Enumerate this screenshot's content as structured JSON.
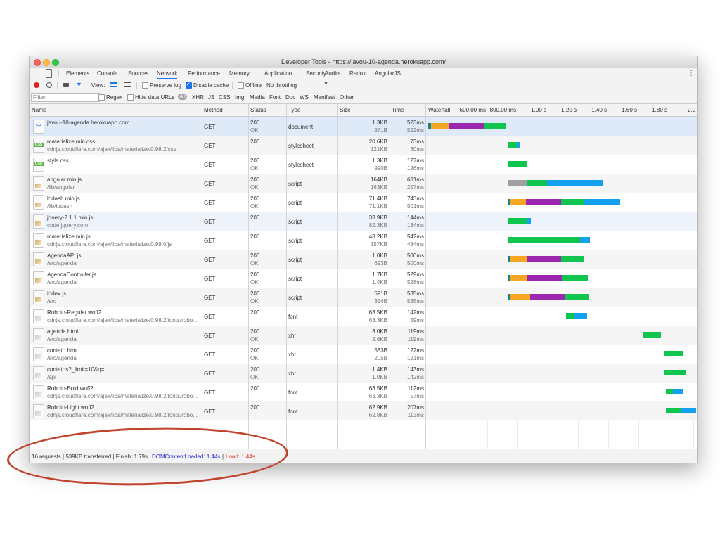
{
  "window": {
    "title": "Developer Tools - https://javou-10-agenda.herokuapp.com/"
  },
  "tabs": [
    "Elements",
    "Console",
    "Sources",
    "Network",
    "Performance",
    "Memory",
    "Application",
    "Security",
    "Audits",
    "Redux",
    "AngularJS"
  ],
  "active_tab": "Network",
  "toolbar": {
    "view_label": "View:",
    "preserve_log": "Preserve log",
    "disable_cache": "Disable cache",
    "offline": "Offline",
    "throttling": "No throttling"
  },
  "filterbar": {
    "filter_placeholder": "Filter",
    "regex": "Regex",
    "hide_data_urls": "Hide data URLs",
    "types": [
      "All",
      "XHR",
      "JS",
      "CSS",
      "Img",
      "Media",
      "Font",
      "Doc",
      "WS",
      "Manifest",
      "Other"
    ]
  },
  "columns": {
    "name": "Name",
    "method": "Method",
    "status": "Status",
    "type": "Type",
    "size": "Size",
    "time": "Time",
    "waterfall": "Waterfall"
  },
  "timeline_ticks": [
    "600.00 ms",
    "800.00 ms",
    "1.00 s",
    "1.20 s",
    "1.40 s",
    "1.60 s",
    "1.80 s",
    "2.0"
  ],
  "requests": [
    {
      "name": "javou-10-agenda.herokuapp.com",
      "path": "",
      "method": "GET",
      "status": "200",
      "status_text": "OK",
      "type": "document",
      "size": "1.3KB",
      "size2": "971B",
      "time": "523ms",
      "time2": "522ms",
      "icon": "html-file-icon"
    },
    {
      "name": "materialize.min.css",
      "path": "cdnjs.cloudflare.com/ajax/libs/materialize/0.98.2/css",
      "method": "GET",
      "status": "200",
      "status_text": "",
      "type": "stylesheet",
      "size": "20.6KB",
      "size2": "121KB",
      "time": "73ms",
      "time2": "60ms",
      "icon": "css-file-icon"
    },
    {
      "name": "style.css",
      "path": "",
      "method": "GET",
      "status": "200",
      "status_text": "OK",
      "type": "stylesheet",
      "size": "1.3KB",
      "size2": "990B",
      "time": "127ms",
      "time2": "126ms",
      "icon": "css-file-icon"
    },
    {
      "name": "angular.min.js",
      "path": "/lib/angular",
      "method": "GET",
      "status": "200",
      "status_text": "OK",
      "type": "script",
      "size": "164KB",
      "size2": "163KB",
      "time": "631ms",
      "time2": "257ms",
      "icon": "js-file-icon"
    },
    {
      "name": "lodash.min.js",
      "path": "/lib/lodash",
      "method": "GET",
      "status": "200",
      "status_text": "OK",
      "type": "script",
      "size": "71.4KB",
      "size2": "71.1KB",
      "time": "743ms",
      "time2": "501ms",
      "icon": "js-file-icon"
    },
    {
      "name": "jquery-2.1.1.min.js",
      "path": "code.jquery.com",
      "method": "GET",
      "status": "200",
      "status_text": "",
      "type": "script",
      "size": "33.9KB",
      "size2": "82.3KB",
      "time": "144ms",
      "time2": "134ms",
      "icon": "js-file-icon"
    },
    {
      "name": "materialize.min.js",
      "path": "cdnjs.cloudflare.com/ajax/libs/materialize/0.99.0/js",
      "method": "GET",
      "status": "200",
      "status_text": "",
      "type": "script",
      "size": "48.2KB",
      "size2": "157KB",
      "time": "542ms",
      "time2": "484ms",
      "icon": "js-file-icon"
    },
    {
      "name": "AgendaAPI.js",
      "path": "/src/agenda",
      "method": "GET",
      "status": "200",
      "status_text": "OK",
      "type": "script",
      "size": "1.0KB",
      "size2": "693B",
      "time": "500ms",
      "time2": "500ms",
      "icon": "js-file-icon"
    },
    {
      "name": "AgendaController.js",
      "path": "/src/agenda",
      "method": "GET",
      "status": "200",
      "status_text": "OK",
      "type": "script",
      "size": "1.7KB",
      "size2": "1.4KB",
      "time": "529ms",
      "time2": "528ms",
      "icon": "js-file-icon"
    },
    {
      "name": "index.js",
      "path": "/src",
      "method": "GET",
      "status": "200",
      "status_text": "OK",
      "type": "script",
      "size": "691B",
      "size2": "314B",
      "time": "535ms",
      "time2": "535ms",
      "icon": "js-file-icon"
    },
    {
      "name": "Roboto-Regular.woff2",
      "path": "cdnjs.cloudflare.com/ajax/libs/materialize/0.98.2/fonts/robo...",
      "method": "GET",
      "status": "200",
      "status_text": "",
      "type": "font",
      "size": "63.5KB",
      "size2": "63.3KB",
      "time": "142ms",
      "time2": "59ms",
      "icon": "font-file-icon"
    },
    {
      "name": "agenda.html",
      "path": "/src/agenda",
      "method": "GET",
      "status": "200",
      "status_text": "OK",
      "type": "xhr",
      "size": "3.0KB",
      "size2": "2.6KB",
      "time": "119ms",
      "time2": "119ms",
      "icon": "font-file-icon"
    },
    {
      "name": "contato.html",
      "path": "/src/agenda",
      "method": "GET",
      "status": "200",
      "status_text": "OK",
      "type": "xhr",
      "size": "583B",
      "size2": "205B",
      "time": "122ms",
      "time2": "121ms",
      "icon": "font-file-icon"
    },
    {
      "name": "contatos?_limit=10&q=",
      "path": "/api",
      "method": "GET",
      "status": "200",
      "status_text": "OK",
      "type": "xhr",
      "size": "1.4KB",
      "size2": "1.0KB",
      "time": "143ms",
      "time2": "142ms",
      "icon": "font-file-icon"
    },
    {
      "name": "Roboto-Bold.woff2",
      "path": "cdnjs.cloudflare.com/ajax/libs/materialize/0.98.2/fonts/robo...",
      "method": "GET",
      "status": "200",
      "status_text": "",
      "type": "font",
      "size": "63.5KB",
      "size2": "63.3KB",
      "time": "112ms",
      "time2": "57ms",
      "icon": "font-file-icon"
    },
    {
      "name": "Roboto-Light.woff2",
      "path": "cdnjs.cloudflare.com/ajax/libs/materialize/0.98.2/fonts/robo...",
      "method": "GET",
      "status": "200",
      "status_text": "",
      "type": "font",
      "size": "62.9KB",
      "size2": "62.8KB",
      "time": "207ms",
      "time2": "113ms",
      "icon": "font-file-icon"
    }
  ],
  "status_bar": {
    "summary": "16 requests | 539KB transferred | Finish: 1.79s |",
    "dom_content_loaded": "DOMContentLoaded: 1.44s",
    "sep": "|",
    "load": "Load: 1.44s"
  },
  "colors": {
    "green": "#0fc550",
    "blue": "#12a0ef",
    "purple": "#9b27b0",
    "orange": "#f5a623",
    "teal": "#1a7f8a",
    "grey": "#a0a0a0",
    "dcl": "#1a1ad8",
    "load": "#e03020",
    "annotation": "#c0442e"
  }
}
